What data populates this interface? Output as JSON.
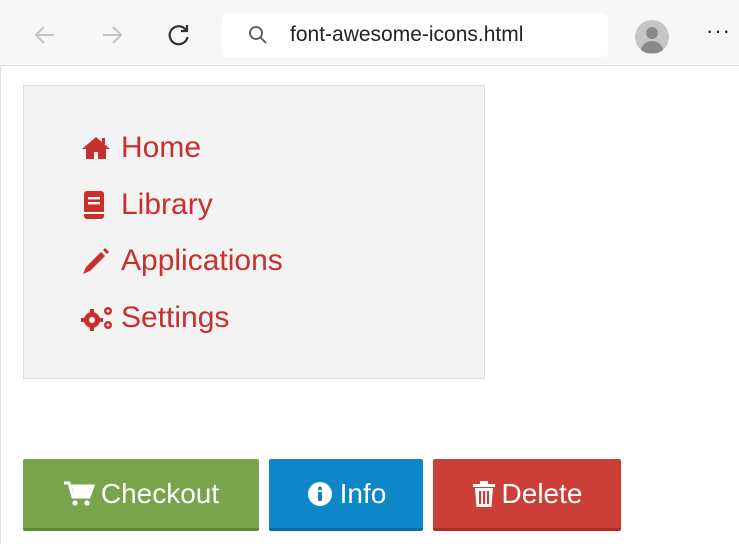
{
  "browser": {
    "address": "font-awesome-icons.html",
    "back_icon": "arrow-left-icon",
    "forward_icon": "arrow-right-icon",
    "reload_icon": "reload-icon",
    "search_icon": "search-icon",
    "more_label": "···"
  },
  "menu": {
    "color": "#c8302e",
    "items": [
      {
        "label": "Home",
        "icon": "home-icon"
      },
      {
        "label": "Library",
        "icon": "book-icon"
      },
      {
        "label": "Applications",
        "icon": "pencil-icon"
      },
      {
        "label": "Settings",
        "icon": "gears-icon"
      }
    ]
  },
  "buttons": {
    "checkout": {
      "label": "Checkout",
      "icon": "cart-icon",
      "color": "#7aa44b"
    },
    "info": {
      "label": "Info",
      "icon": "info-circle-icon",
      "color": "#0d87c8"
    },
    "delete": {
      "label": "Delete",
      "icon": "trash-icon",
      "color": "#cc3f38"
    }
  }
}
